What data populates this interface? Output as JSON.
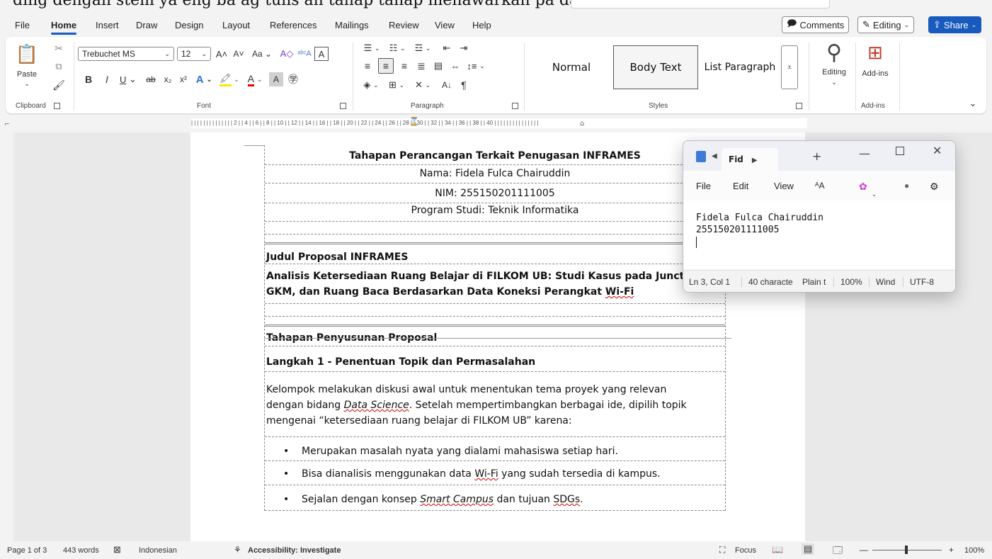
{
  "menu": {
    "tabs": [
      "File",
      "Home",
      "Insert",
      "Draw",
      "Design",
      "Layout",
      "References",
      "Mailings",
      "Review",
      "View",
      "Help"
    ],
    "active": "Home",
    "comments_label": "Comments",
    "editing_label": "Editing",
    "share_label": "Share"
  },
  "ribbon": {
    "clipboard": {
      "paste_label": "Paste",
      "group_label": "Clipboard"
    },
    "font": {
      "font_name": "Trebuchet MS",
      "font_size": "12",
      "group_label": "Font",
      "case_label": "Aa"
    },
    "paragraph": {
      "group_label": "Paragraph"
    },
    "styles": {
      "items": [
        "Normal",
        "Body Text",
        "List Paragraph"
      ],
      "selected": "Body Text",
      "group_label": "Styles"
    },
    "editing": {
      "label": "Editing"
    },
    "addins": {
      "label": "Add-ins",
      "group_label": "Add-ins"
    }
  },
  "ruler": {
    "ticks": "| | | | | | | | | | | |   |   | 2 |   | 4 |   | 6 |   | 8 |   | 10 |   | 12 |   | 14 |   | 16 |   | 18 |   | 20 |   | 22 |   | 24 |   | 26 |   | 28 |   | 30 |   | 32 |   | 34 |   | 36 |   | 38 |   | 40 | | | | | | | | | | | | | | |"
  },
  "document": {
    "header_rows": [
      "Tahapan Perancangan Terkait Penugasan INFRAMES",
      "Nama: Fidela Fulca Chairuddin",
      "NIM: 255150201111005",
      "Program Studi: Teknik Informatika"
    ],
    "judul_heading": "Judul Proposal INFRAMES",
    "judul_text_1": "Analisis Ketersediaan Ruang Belajar di FILKOM UB: Studi Kasus pada Junction,",
    "judul_text_2a": "GKM, dan Ruang Baca Berdasarkan Data Koneksi Perangkat ",
    "judul_text_2b": "Wi-Fi",
    "tahapan_heading": "Tahapan Penyusunan Proposal",
    "langkah_heading": "Langkah 1 - Penentuan Topik dan Permasalahan",
    "para_1": "Kelompok melakukan diskusi awal untuk menentukan tema proyek yang relevan",
    "para_2a": "dengan bidang ",
    "para_2b": "Data Science",
    "para_2c": ". Setelah mempertimbangkan berbagai ide, dipilih topik",
    "para_3": "mengenai “ketersediaan ruang belajar di FILKOM UB” karena:",
    "bullet_1": "Merupakan masalah nyata yang dialami mahasiswa setiap hari.",
    "bullet_2a": "Bisa dianalisis menggunakan data ",
    "bullet_2b": "Wi-Fi",
    "bullet_2c": " yang sudah tersedia di kampus.",
    "bullet_3a": "Sejalan dengan konsep ",
    "bullet_3b": "Smart Campus",
    "bullet_3c": " dan tujuan ",
    "bullet_3d": "SDGs",
    "bullet_3e": "."
  },
  "notepad": {
    "tab_title": "Fid",
    "menu": [
      "File",
      "Edit",
      "View"
    ],
    "line_1": "Fidela Fulca Chairuddin",
    "line_2": "255150201111005",
    "status": {
      "position": "Ln 3, Col 1",
      "chars": "40 characte",
      "format": "Plain t",
      "zoom": "100%",
      "eol": "Wind",
      "encoding": "UTF-8"
    }
  },
  "statusbar": {
    "page": "Page 1 of 3",
    "words": "443 words",
    "language": "Indonesian",
    "accessibility": "Accessibility: Investigate",
    "focus": "Focus",
    "zoom": "100%"
  }
}
